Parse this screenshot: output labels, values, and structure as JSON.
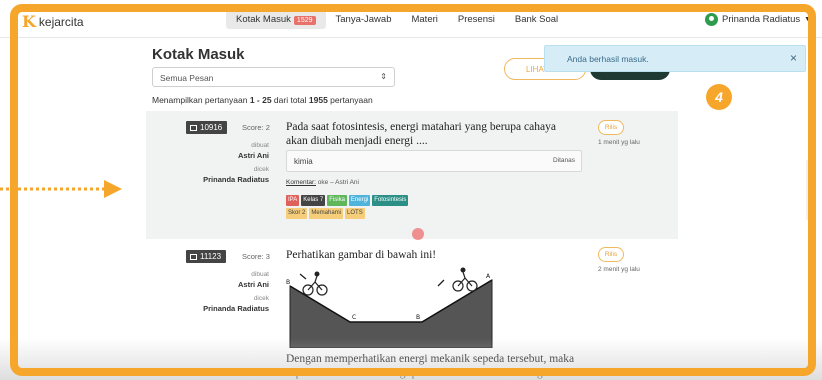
{
  "brand": {
    "name": "kejarcita"
  },
  "nav": {
    "items": [
      {
        "label": "Kotak Masuk",
        "badge": "1529",
        "active": true
      },
      {
        "label": "Tanya-Jawab"
      },
      {
        "label": "Materi"
      },
      {
        "label": "Presensi"
      },
      {
        "label": "Bank Soal"
      }
    ]
  },
  "user": {
    "name": "Prinanda Radiatus"
  },
  "page": {
    "title": "Kotak Masuk",
    "filter_value": "Semua Pesan",
    "showing_prefix": "Menampilkan pertanyaan ",
    "showing_range": "1 - 25",
    "showing_mid": " dari total ",
    "showing_total": "1955",
    "showing_suffix": " pertanyaan",
    "lihat_label": "LIHAT"
  },
  "toast": {
    "message": "Anda berhasil masuk."
  },
  "step_number": "4",
  "questions": [
    {
      "id": "10916",
      "score": "Score: 2",
      "created_label": "dibuat",
      "created_by": "Astri Ani",
      "checked_label": "dicek",
      "checked_by": "Prinanda Radiatus",
      "text": "Pada saat fotosintesis, energi matahari yang berupa cahaya akan diubah menjadi energi ....",
      "subject": "kimia",
      "subject_status": "Ditanas",
      "comment_label": "Komentar:",
      "comment_text": " oke – Astri Ani",
      "tags_row1": [
        "IPA",
        "Kelas 7",
        "Fisika",
        "Energi",
        "Fotosintesis"
      ],
      "tags_row2": [
        "Skor 2",
        "Memahami",
        "LOTS"
      ],
      "status": "Rilis",
      "time": "1 menit yg lalu"
    },
    {
      "id": "11123",
      "score": "Score: 3",
      "created_label": "dibuat",
      "created_by": "Astri Ani",
      "checked_label": "dicek",
      "checked_by": "Prinanda Radiatus",
      "text": "Perhatikan gambar di bawah ini!",
      "text_bottom": "Dengan memperhatikan energi mekanik sepeda tersebut, maka sepeda berenak dari energi potensial maksimal ke energi kinetik maksimal",
      "status": "Rilis",
      "time": "2 menit yg lalu",
      "figure_labels": [
        "B",
        "C",
        "B",
        "A"
      ]
    }
  ],
  "colors": {
    "frame": "#f7a62c",
    "toast_bg": "#d6edf8",
    "active_nav": "#e9e9e9"
  }
}
